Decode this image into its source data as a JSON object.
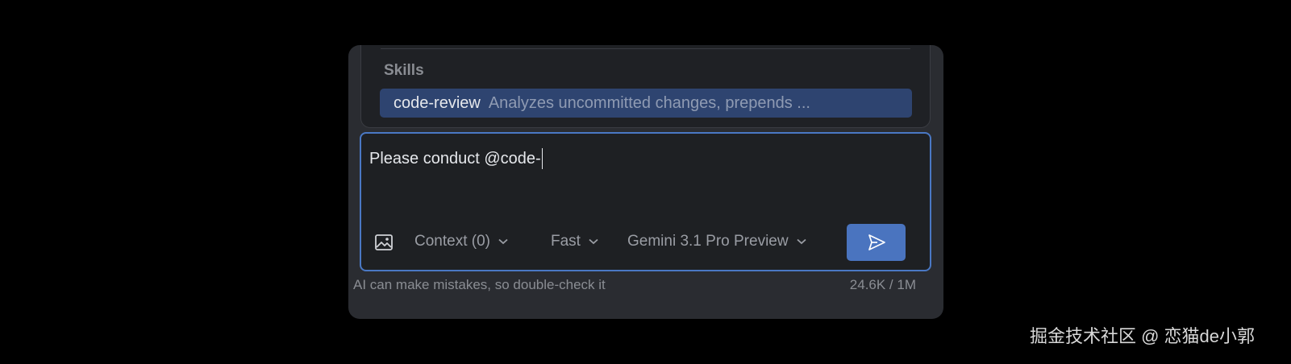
{
  "skills_popup": {
    "header": "Skills",
    "items": [
      {
        "name": "code-review",
        "description": "Analyzes uncommitted changes, prepends ..."
      }
    ]
  },
  "input": {
    "value": "Please conduct @code-"
  },
  "toolbar": {
    "image_icon": "image-icon",
    "context_label": "Context (0)",
    "speed_label": "Fast",
    "model_label": "Gemini 3.1 Pro Preview",
    "send_icon": "send-icon"
  },
  "footer": {
    "disclaimer": "AI can make mistakes, so double-check it",
    "token_usage": "24.6K / 1M"
  },
  "watermark": "掘金技术社区 @ 恋猫de小郭",
  "colors": {
    "accent": "#4a78c4",
    "selected_item_bg": "#2e4470",
    "send_button": "#4a74bf"
  }
}
